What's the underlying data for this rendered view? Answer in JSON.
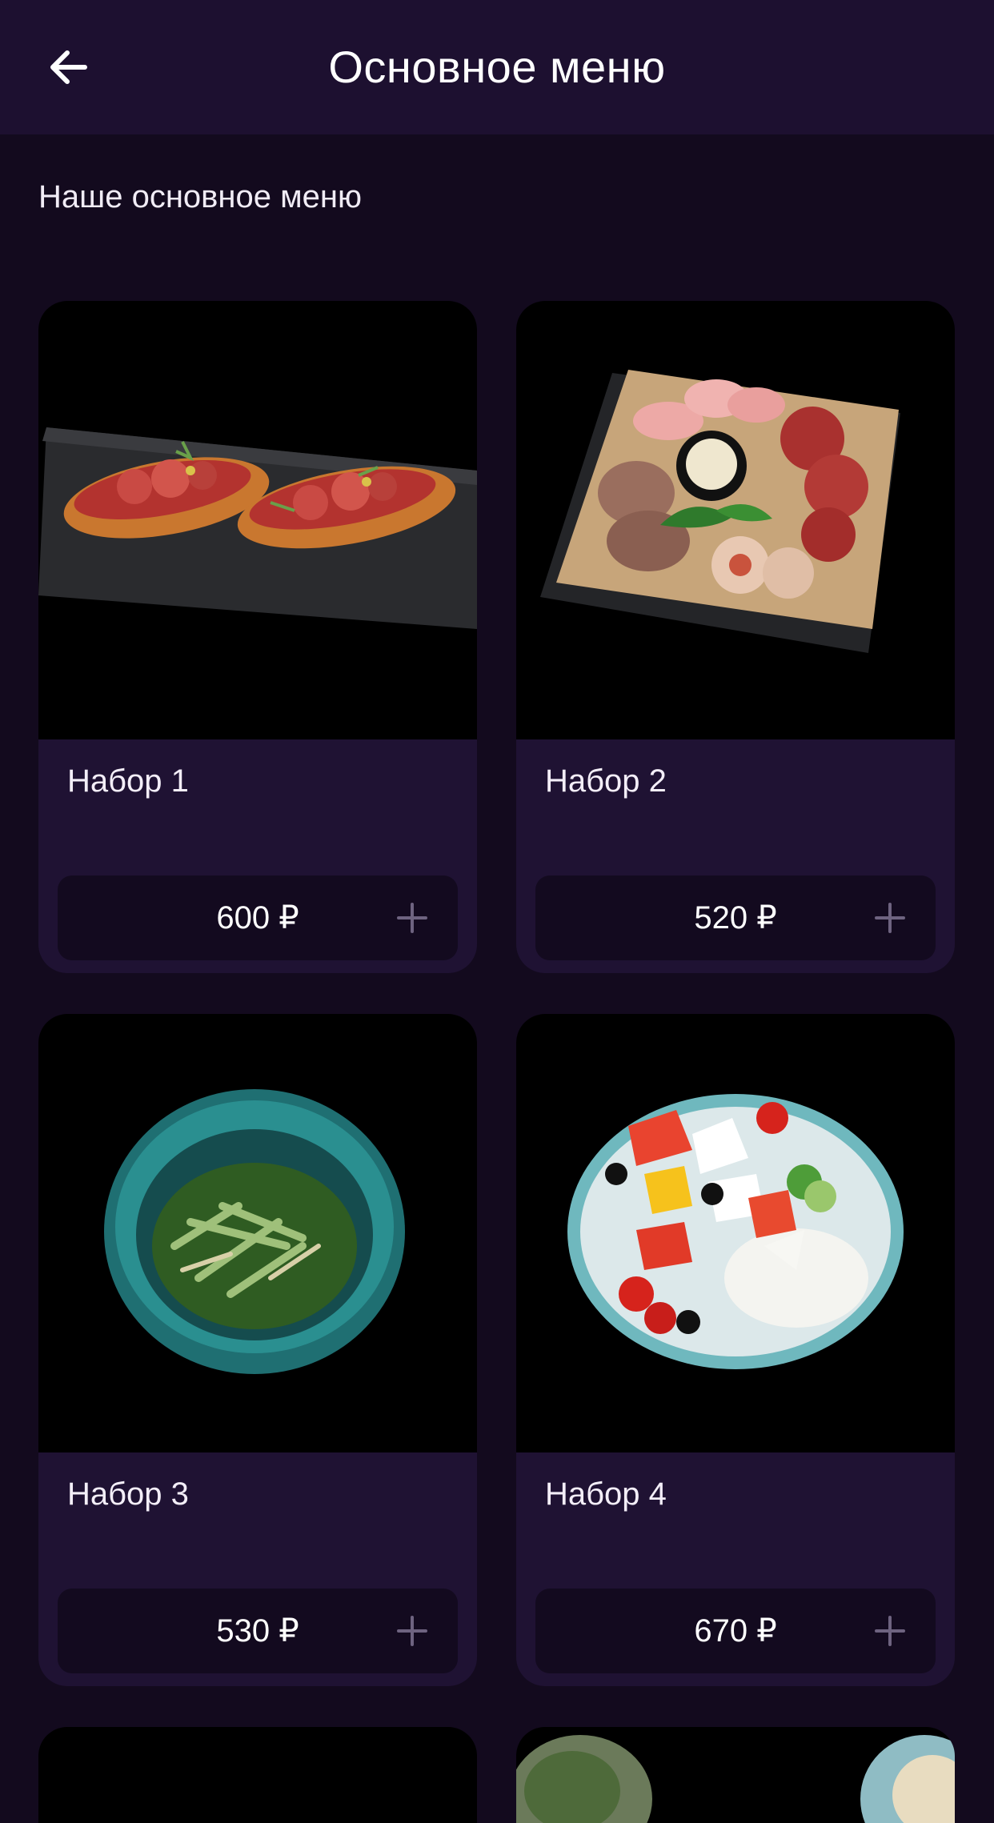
{
  "header": {
    "title": "Основное меню",
    "back_icon": "arrow-left-icon"
  },
  "section": {
    "subtitle": "Наше основное меню"
  },
  "colors": {
    "header_bg": "#1d1030",
    "page_bg": "#130a1e",
    "card_bg": "#1f1233",
    "price_bar_bg": "#130a1f",
    "plus_icon": "#6e6380"
  },
  "menu": {
    "items": [
      {
        "name": "Набор 1",
        "price": "600 ₽",
        "image": "bruschetta-salami"
      },
      {
        "name": "Набор 2",
        "price": "520 ₽",
        "image": "meat-platter"
      },
      {
        "name": "Набор 3",
        "price": "530 ₽",
        "image": "cucumber-salad-bowl"
      },
      {
        "name": "Набор 4",
        "price": "670 ₽",
        "image": "greek-salad-plate"
      }
    ]
  }
}
